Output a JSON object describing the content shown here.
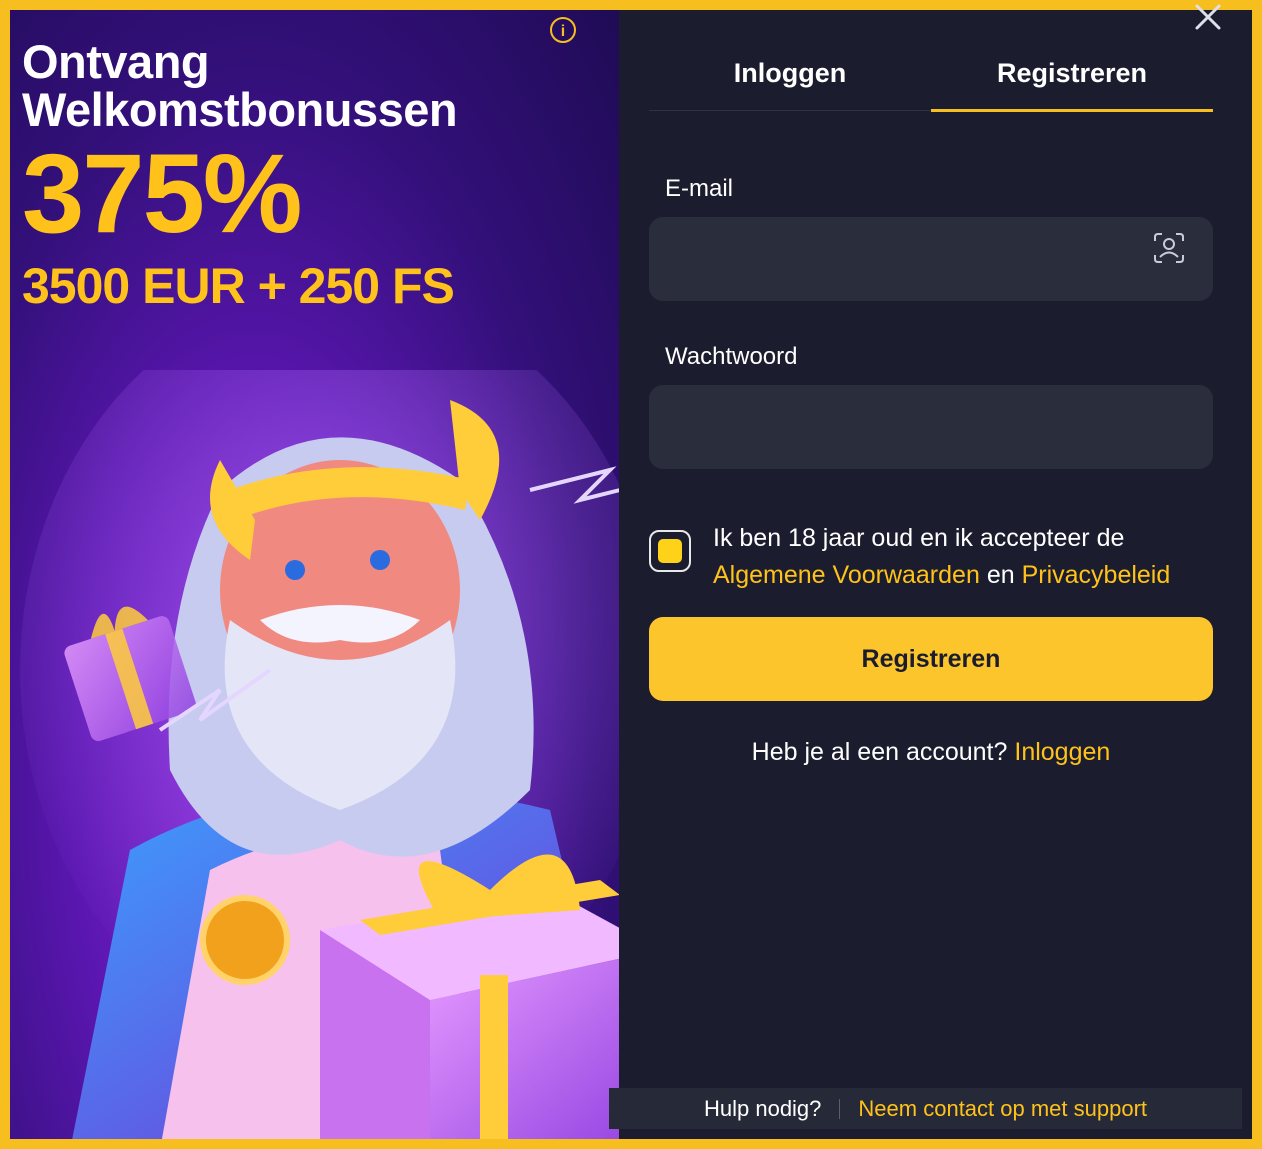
{
  "promo": {
    "title_line1": "Ontvang",
    "title_line2": "Welkomstbonussen",
    "percent": "375%",
    "amount": "3500 EUR + 250 FS",
    "info_icon": "info-icon",
    "hero_image": "zeus-character-holding-gift"
  },
  "tabs": [
    {
      "label": "Inloggen",
      "active": false
    },
    {
      "label": "Registreren",
      "active": true
    }
  ],
  "form": {
    "email_label": "E-mail",
    "email_value": "",
    "password_label": "Wachtwoord",
    "password_value": "",
    "email_icon": "user-scan-icon",
    "terms_prefix": "Ik ben 18 jaar oud en ik accepteer de",
    "terms_link": "Algemene Voorwaarden",
    "terms_conjunction": "en",
    "privacy_link": "Privacybeleid",
    "checkbox_checked": true,
    "submit_label": "Registreren",
    "have_account": "Heb je al een account?",
    "login_link": "Inloggen"
  },
  "footer": {
    "help": "Hulp nodig?",
    "support_link": "Neem contact op met support"
  },
  "colors": {
    "accent": "#f6be1f",
    "panel_bg": "#1b1d2e",
    "field_bg": "#2a2d3c",
    "promo_bg": "#33107a"
  }
}
